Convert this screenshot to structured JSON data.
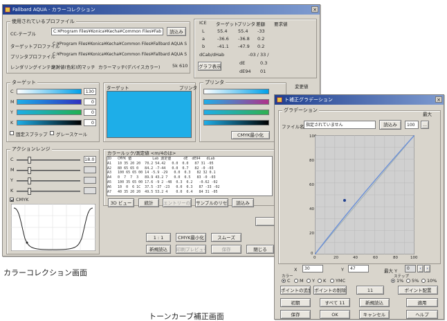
{
  "colors": {
    "title_bar": "#1f3f8f",
    "window_bg": "#d9d5cc",
    "preview_cyan": "#1eaee8",
    "curve_line": "#6a8fd8"
  },
  "main": {
    "title": "Fallbard AQUA - カラーコレクション",
    "profile_group": "使用されているプロファイル",
    "rows": [
      {
        "label": "CC-テーブル",
        "value": "C:¥Program Files¥Konica¥Kecha¥Common Files¥Fab",
        "button": "読込み"
      },
      {
        "label": "ターゲットプロファイル",
        "value": "C:¥Program Files¥Konica¥Kecha¥Common Files¥Fallbard AQUA Smi"
      },
      {
        "label": "プリンタプロファイル",
        "value": "C:¥Program Files¥Konica¥Kecha¥Common Files¥Fallbard AQUA Smi"
      },
      {
        "label": "レンダリングインテント",
        "value": "絶対値(色彩)的マッチ",
        "extra_label": "カラーマッチ(デバイスカラー)",
        "extra_value": "5k 610"
      }
    ],
    "lab": {
      "headers": [
        "ICE",
        "ターゲット",
        "プリンタ",
        "差額",
        "要求値"
      ],
      "rows": [
        [
          "L",
          "55.4",
          "55.4",
          "-33"
        ],
        [
          "a",
          "-36.6",
          "-36.8",
          "0.2"
        ],
        [
          "b",
          "-41.1",
          "-47.9",
          "0.2"
        ]
      ],
      "dE_label": "dCab/dHab",
      "dE_vals": "-03 / 33 /",
      "graph_button": "グラフ表示",
      "dE": "dE",
      "dE_val": "0.3",
      "dE94": "dE94",
      "dE94_val": "01"
    },
    "target": {
      "label": "ターゲット",
      "channels": [
        {
          "ch": "C",
          "value": "130"
        },
        {
          "ch": "M",
          "value": "0"
        },
        {
          "ch": "Y",
          "value": "0"
        },
        {
          "ch": "K",
          "value": "0"
        }
      ],
      "check1": "固定スプラップ",
      "check2": "グレースケール"
    },
    "target_printer": {
      "left": "ターゲット",
      "right": "プリンタ"
    },
    "printer": {
      "label": "プリンタ",
      "button": "CMYK最小化",
      "extra": "変更値"
    },
    "actual": {
      "label": "アクションレンジ",
      "channels": [
        {
          "ch": "C",
          "value": "18.0"
        },
        {
          "ch": "M",
          "value": ""
        },
        {
          "ch": "Y",
          "value": ""
        },
        {
          "ch": "K",
          "value": ""
        }
      ],
      "cmyk_check": "CMYK"
    },
    "list": {
      "label": "カラールック/測定値 <m/4のは>",
      "rows": [
        "ID   CMYK 値          Lab 測定値      dE  dE94   dLab",
        "A1   10 35 20 20  70.2 54.42   0.0  0.0   87 31 -05",
        "A2   80 65 65 0   84.2 -7-44   0.0  0.7   82 -0 -03",
        "A3   100 65 65 00 14 -5.9 -29   0.0  0.3   82 32 0.1",
        "A4   0  7  7  3   89.9 43.2 7   0.0  0.5   83 -0 -03",
        "A5   100 35 65 00 17.6 -9 2 -48  0.3  0.2   -0.62 -02",
        "A6   10  0  6 1C  37.5 -37 -23   0.0  0.3   87 -33 -02",
        "A7   40 35 20 20  49.5 53.2 4    0.0  0.4   84 31 -05"
      ]
    },
    "buttons": {
      "view3d": "3D ビュー",
      "stats": "統計",
      "entry": "エントリーの詳細",
      "sample_reset": "サンプルのリセット",
      "load": "読込み",
      "one_one": "1 : 1",
      "cmyk_min": "CMYK最小化",
      "smooth": "スムーズ",
      "newload": "新規読込",
      "print": "印刷プレビュー",
      "save": "保存",
      "close": "閉じる"
    }
  },
  "tone": {
    "title": "ト補正グラデーション",
    "group": "グラデーション",
    "max_label": "最大",
    "file_label": "ファイル名",
    "file_value": "指定されていません",
    "file_button": "読込み",
    "max_value": "100",
    "axis_y": [
      "100",
      "80",
      "60",
      "40",
      "20",
      "0"
    ],
    "axis_x": [
      "0",
      "20",
      "40",
      "60",
      "80",
      "100"
    ],
    "x_label": "X",
    "x_value": "30",
    "y_label": "Y",
    "y_value": "47",
    "maxy_label": "最大 Y",
    "maxy_value": "0",
    "color_label": "カラー",
    "colors": [
      "C",
      "M",
      "Y",
      "K",
      "YMC"
    ],
    "step_label": "ステップ",
    "steps": [
      "1%",
      "5%",
      "10%"
    ],
    "btns1": [
      "ポイントの追加",
      "ポイントの削除",
      "11",
      "ポイント配置"
    ],
    "btns2": [
      "初期",
      "すべて 11",
      "新規読込",
      "適用"
    ],
    "btns3": [
      "保存",
      "OK",
      "キャンセル",
      "ヘルプ"
    ]
  },
  "captions": {
    "color_correction": "カラーコレクション画面",
    "tone_curve": "トーンカーブ補正画面"
  }
}
